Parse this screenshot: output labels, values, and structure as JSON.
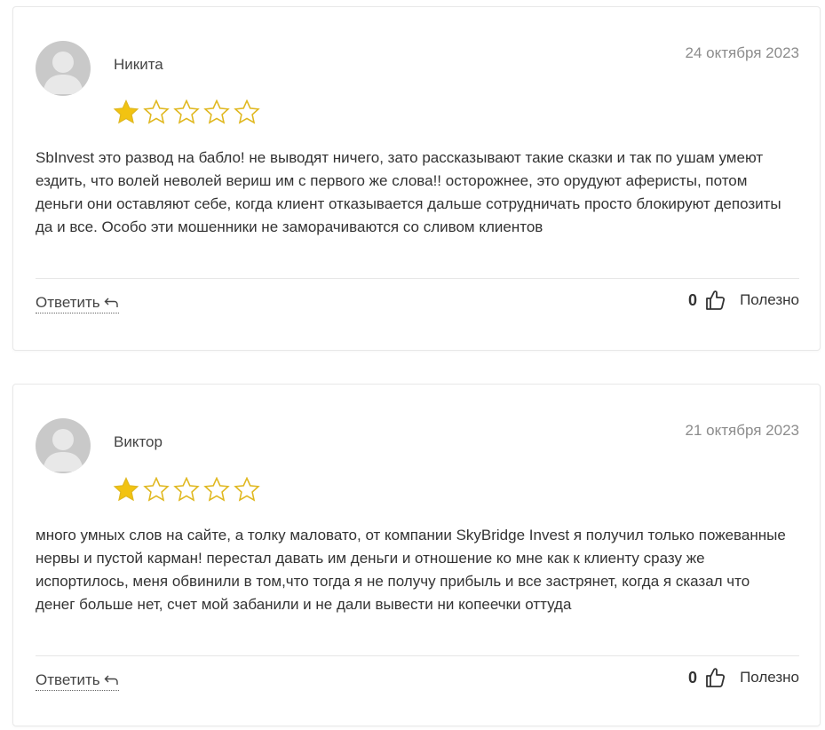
{
  "reviews": [
    {
      "author": "Никита",
      "date": "24 октября 2023",
      "rating": 1,
      "max_rating": 5,
      "text": "SbInvest это развод на бабло! не выводят ничего, зато рассказывают такие сказки и так по ушам умеют ездить, что волей неволей вериш им с первого же слова!! осторожнее, это орудуют аферисты, потом деньги они оставляют себе, когда клиент отказывается дальше сотрудничать просто блокируют депозиты да и все. Особо эти мошенники не заморачиваются со сливом клиентов",
      "reply_label": "Ответить",
      "helpful_count": "0",
      "helpful_label": "Полезно"
    },
    {
      "author": "Виктор",
      "date": "21 октября 2023",
      "rating": 1,
      "max_rating": 5,
      "text": "много умных слов на сайте, а толку маловато, от компании SkyBridge Invest я получил только пожеванные нервы и пустой карман! перестал давать им деньги и отношение ко мне как к клиенту сразу же испортилось, меня обвинили в том,что тогда я не получу прибыль и все застрянет, когда я сказал что денег больше нет, счет мой забанили и не дали вывести ни копеечки оттуда",
      "reply_label": "Ответить",
      "helpful_count": "0",
      "helpful_label": "Полезно"
    }
  ],
  "colors": {
    "star_filled": "#F2C311",
    "star_outline": "#E0B820",
    "avatar_bg": "#C9C9C9",
    "avatar_fg": "#E8E8E8",
    "date": "#8C8C8C"
  },
  "icons": {
    "avatar": "user-silhouette-icon",
    "star": "star-icon",
    "reply": "reply-arrow-icon",
    "helpful": "thumbs-up-icon"
  }
}
